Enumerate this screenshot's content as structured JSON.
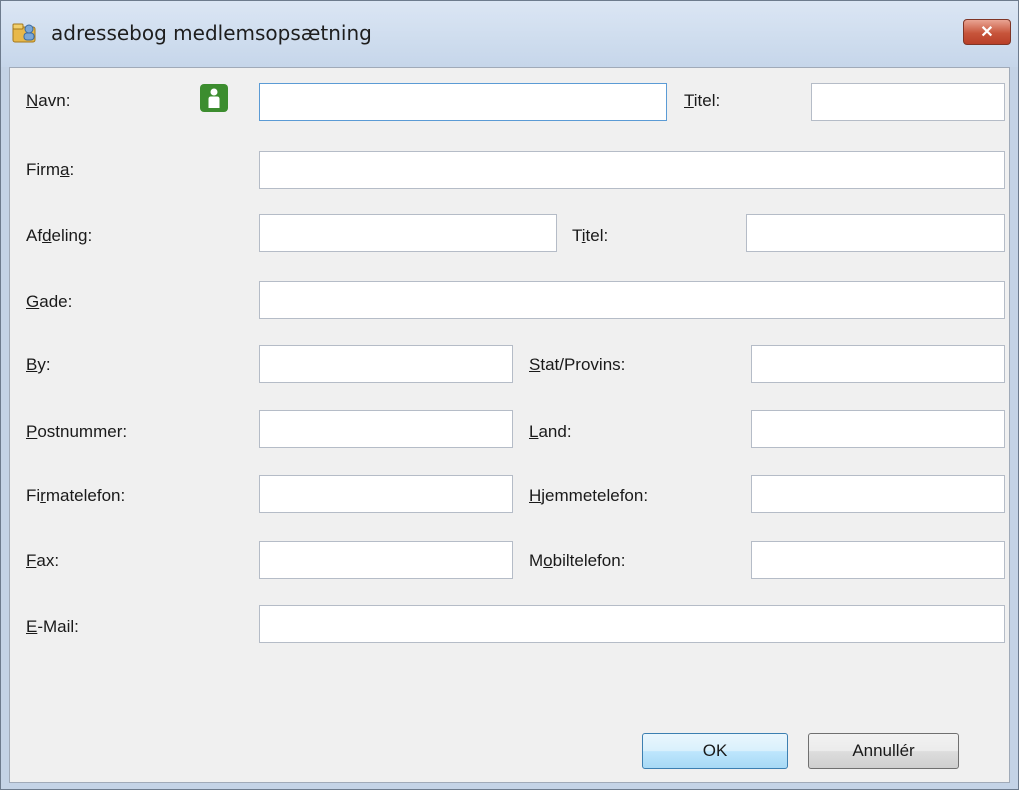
{
  "window": {
    "title": "adressebog medlemsopsætning",
    "close_symbol": "✕"
  },
  "form": {
    "name": {
      "label_pre": "",
      "accel": "N",
      "label_post": "avn:",
      "value": ""
    },
    "title1": {
      "label_pre": "",
      "accel": "T",
      "label_post": "itel:",
      "value": ""
    },
    "company": {
      "label_pre": "Firm",
      "accel": "a",
      "label_post": ":",
      "value": ""
    },
    "department": {
      "label_pre": "Af",
      "accel": "d",
      "label_post": "eling:",
      "value": ""
    },
    "title2": {
      "label_pre": "T",
      "accel": "i",
      "label_post": "tel:",
      "value": ""
    },
    "street": {
      "label_pre": "",
      "accel": "G",
      "label_post": "ade:",
      "value": ""
    },
    "city": {
      "label_pre": "",
      "accel": "B",
      "label_post": "y:",
      "value": ""
    },
    "state": {
      "label_pre": "",
      "accel": "S",
      "label_post": "tat/Provins:",
      "value": ""
    },
    "zip": {
      "label_pre": "",
      "accel": "P",
      "label_post": "ostnummer:",
      "value": ""
    },
    "country": {
      "label_pre": "",
      "accel": "L",
      "label_post": "and:",
      "value": ""
    },
    "work_phone": {
      "label_pre": "Fi",
      "accel": "r",
      "label_post": "matelefon:",
      "value": ""
    },
    "home_phone": {
      "label_pre": "",
      "accel": "H",
      "label_post": "jemmetelefon:",
      "value": ""
    },
    "fax": {
      "label_pre": "",
      "accel": "F",
      "label_post": "ax:",
      "value": ""
    },
    "mobile": {
      "label_pre": "M",
      "accel": "o",
      "label_post": "biltelefon:",
      "value": ""
    },
    "email": {
      "label_pre": "",
      "accel": "E",
      "label_post": "-Mail:",
      "value": ""
    }
  },
  "buttons": {
    "ok": "OK",
    "cancel": "Annullér"
  },
  "icons": {
    "window": "address-book-icon",
    "contact": "contact-person-icon"
  },
  "colors": {
    "contact_icon_green": "#3c8d2f",
    "close_red": "#c7553b"
  }
}
